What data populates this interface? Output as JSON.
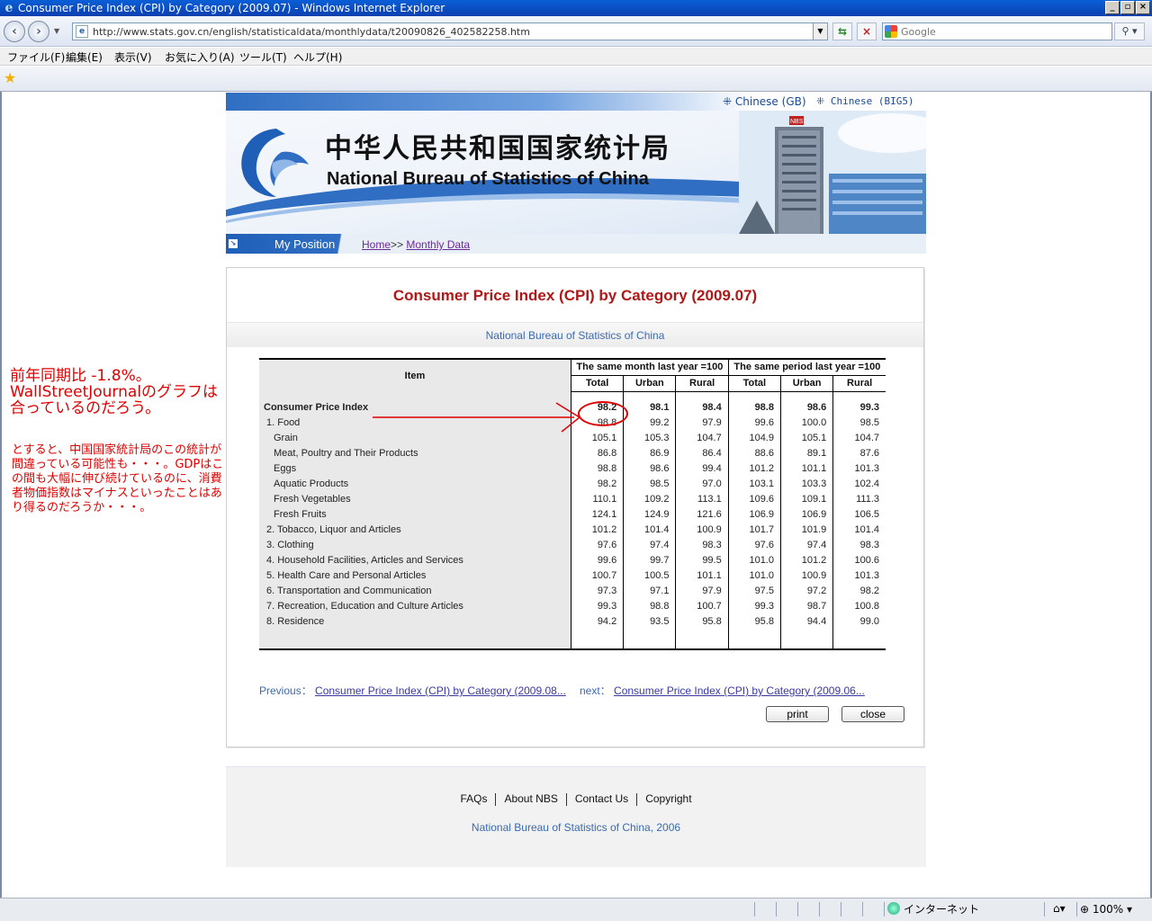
{
  "window": {
    "title": "Consumer Price Index (CPI) by Category (2009.07) - Windows Internet Explorer",
    "address": "http://www.stats.gov.cn/english/statisticaldata/monthlydata/t20090826_402582258.htm",
    "search_placeholder": "Google",
    "menu": [
      "ファイル(F)",
      "編集(E)",
      "表示(V)",
      "お気に入り(A)",
      "ツール(T)",
      "ヘルプ(H)"
    ]
  },
  "header": {
    "lang_gb": "Chinese (GB)",
    "lang_big5": "Chinese (BIG5)",
    "cn_title": "中华人民共和国国家统计局",
    "en_title": "National Bureau of Statistics of China",
    "building_sign": "NBS"
  },
  "breadcrumb": {
    "label": "My Position",
    "home": "Home",
    "sep": ">>",
    "current": "Monthly Data"
  },
  "page": {
    "heading": "Consumer Price Index (CPI) by Category (2009.07)",
    "source": "National Bureau of Statistics of China"
  },
  "table": {
    "item_header": "Item",
    "group1": "The same month last year =100",
    "group2": "The same period last year =100",
    "subheaders": [
      "Total",
      "Urban",
      "Rural",
      "Total",
      "Urban",
      "Rural"
    ],
    "rows": [
      {
        "label": "Consumer Price Index",
        "values": [
          "98.2",
          "98.1",
          "98.4",
          "98.8",
          "98.6",
          "99.3"
        ]
      },
      {
        "label": "1. Food",
        "values": [
          "98.8",
          "99.2",
          "97.9",
          "99.6",
          "100.0",
          "98.5"
        ]
      },
      {
        "label": "Grain",
        "values": [
          "105.1",
          "105.3",
          "104.7",
          "104.9",
          "105.1",
          "104.7"
        ]
      },
      {
        "label": "Meat, Poultry and Their Products",
        "values": [
          "86.8",
          "86.9",
          "86.4",
          "88.6",
          "89.1",
          "87.6"
        ]
      },
      {
        "label": "Eggs",
        "values": [
          "98.8",
          "98.6",
          "99.4",
          "101.2",
          "101.1",
          "101.3"
        ]
      },
      {
        "label": "Aquatic Products",
        "values": [
          "98.2",
          "98.5",
          "97.0",
          "103.1",
          "103.3",
          "102.4"
        ]
      },
      {
        "label": "Fresh Vegetables",
        "values": [
          "110.1",
          "109.2",
          "113.1",
          "109.6",
          "109.1",
          "111.3"
        ]
      },
      {
        "label": "Fresh Fruits",
        "values": [
          "124.1",
          "124.9",
          "121.6",
          "106.9",
          "106.9",
          "106.5"
        ]
      },
      {
        "label": "2. Tobacco, Liquor and Articles",
        "values": [
          "101.2",
          "101.4",
          "100.9",
          "101.7",
          "101.9",
          "101.4"
        ]
      },
      {
        "label": "3. Clothing",
        "values": [
          "97.6",
          "97.4",
          "98.3",
          "97.6",
          "97.4",
          "98.3"
        ]
      },
      {
        "label": "4. Household Facilities, Articles and Services",
        "values": [
          "99.6",
          "99.7",
          "99.5",
          "101.0",
          "101.2",
          "100.6"
        ]
      },
      {
        "label": "5. Health Care and Personal Articles",
        "values": [
          "100.7",
          "100.5",
          "101.1",
          "101.0",
          "100.9",
          "101.3"
        ]
      },
      {
        "label": "6. Transportation and Communication",
        "values": [
          "97.3",
          "97.1",
          "97.9",
          "97.5",
          "97.2",
          "98.2"
        ]
      },
      {
        "label": "7. Recreation, Education and Culture Articles",
        "values": [
          "99.3",
          "98.8",
          "100.7",
          "99.3",
          "98.7",
          "100.8"
        ]
      },
      {
        "label": "8. Residence",
        "values": [
          "94.2",
          "93.5",
          "95.8",
          "95.8",
          "94.4",
          "99.0"
        ]
      }
    ]
  },
  "prevnext": {
    "prev_label": "Previous：",
    "prev_link": "Consumer Price Index (CPI) by Category (2009.08...",
    "next_label": "next：",
    "next_link": "Consumer Price Index (CPI) by Category (2009.06..."
  },
  "buttons": {
    "print": "print",
    "close": "close"
  },
  "footer": {
    "links": [
      "FAQs",
      "About NBS",
      "Contact Us",
      "Copyright"
    ],
    "copyright": "National Bureau of Statistics of China, 2006"
  },
  "annotation": {
    "main": "前年同期比 -1.8%。WallStreetJournalのグラフは合っているのだろう。",
    "sub": "とすると、中国国家統計局のこの統計が間違っている可能性も・・・。GDPはこの間も大幅に伸び続けているのに、消費者物価指数はマイナスといったことはあり得るのだろうか・・・。"
  },
  "status": {
    "zone": "インターネット",
    "zoom": "100%"
  },
  "colors": {
    "accent_red": "#e00000",
    "heading_red": "#b01818",
    "nbs_blue": "#2f6ec2"
  }
}
